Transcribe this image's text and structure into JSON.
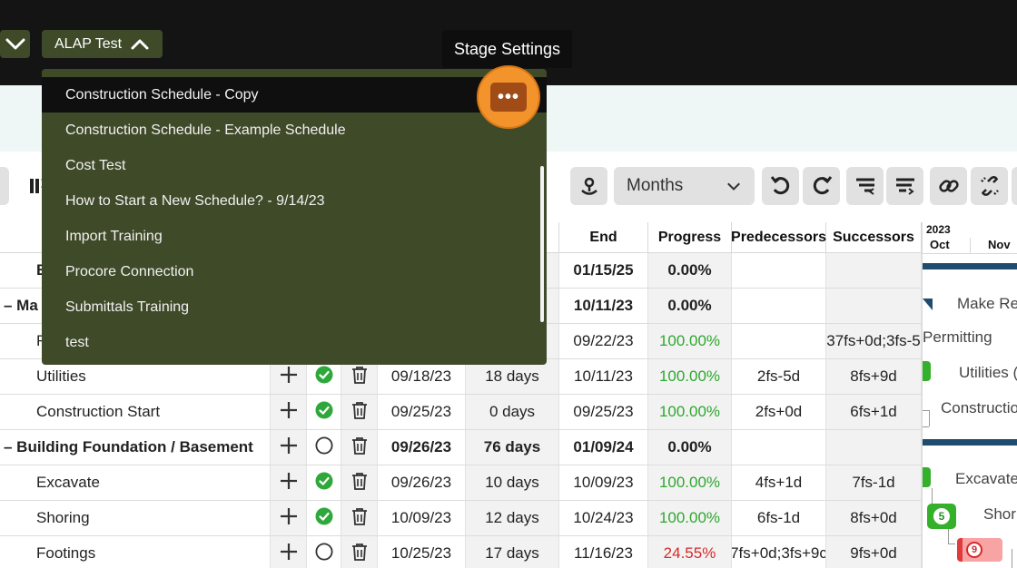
{
  "topbar": {
    "left_toggle_icon": "chevron-down-icon",
    "alap_label": "ALAP Test",
    "alap_icon": "chevron-up-icon",
    "tooltip": "Stage Settings"
  },
  "dropdown": {
    "items": [
      "Construction Schedule - Copy",
      "Construction Schedule - Example Schedule",
      "Cost Test",
      "How to Start a New Schedule? - 9/14/23",
      "Import Training",
      "Procore Connection",
      "Submittals Training",
      "test"
    ],
    "active_index": 0,
    "more_label": "•••"
  },
  "toolbar": {
    "months_label": "Months"
  },
  "table": {
    "headers": {
      "end": "End",
      "progress": "Progress",
      "predecessors": "Predecessors",
      "successors": "Successors"
    },
    "rows": [
      {
        "name": "Buildi",
        "start": "",
        "duration": "",
        "end": "01/15/25",
        "progress": "0.00%",
        "pred": "",
        "succ": "",
        "bold": true
      },
      {
        "name": "– Ma",
        "start": "",
        "duration": "",
        "end": "10/11/23",
        "progress": "0.00%",
        "pred": "",
        "succ": "",
        "bold": true
      },
      {
        "name": "F",
        "start": "",
        "duration": "",
        "end": "09/22/23",
        "progress": "100.00%",
        "pred": "",
        "succ": "37fs+0d;3fs-5"
      },
      {
        "name": "Utilities",
        "start": "09/18/23",
        "duration": "18 days",
        "end": "10/11/23",
        "progress": "100.00%",
        "pred": "2fs-5d",
        "succ": "8fs+9d"
      },
      {
        "name": "Construction Start",
        "start": "09/25/23",
        "duration": "0 days",
        "end": "09/25/23",
        "progress": "100.00%",
        "pred": "2fs+0d",
        "succ": "6fs+1d"
      },
      {
        "name": "– Building Foundation / Basement",
        "start": "09/26/23",
        "duration": "76 days",
        "end": "01/09/24",
        "progress": "0.00%",
        "pred": "",
        "succ": "",
        "bold": true
      },
      {
        "name": "Excavate",
        "start": "09/26/23",
        "duration": "10 days",
        "end": "10/09/23",
        "progress": "100.00%",
        "pred": "4fs+1d",
        "succ": "7fs-1d"
      },
      {
        "name": "Shoring",
        "start": "10/09/23",
        "duration": "12 days",
        "end": "10/24/23",
        "progress": "100.00%",
        "pred": "6fs-1d",
        "succ": "8fs+0d"
      },
      {
        "name": "Footings",
        "start": "10/25/23",
        "duration": "17 days",
        "end": "11/16/23",
        "progress": "24.55%",
        "pred": "7fs+0d;3fs+9c",
        "succ": "9fs+0d"
      }
    ]
  },
  "gantt": {
    "year": "2023",
    "months": [
      "Oct",
      "Nov"
    ],
    "labels": [
      "Make Re",
      "Permitting",
      "Utilities (",
      "Constructio",
      "Excavate",
      "Shori"
    ],
    "badges": [
      "5",
      "9"
    ]
  },
  "colors": {
    "menu_bg": "#3f4a29",
    "highlight": "#f2932b",
    "progress_green": "#2ea82e",
    "progress_red": "#d62a2a",
    "gantt_bar": "#1f4b6e"
  }
}
